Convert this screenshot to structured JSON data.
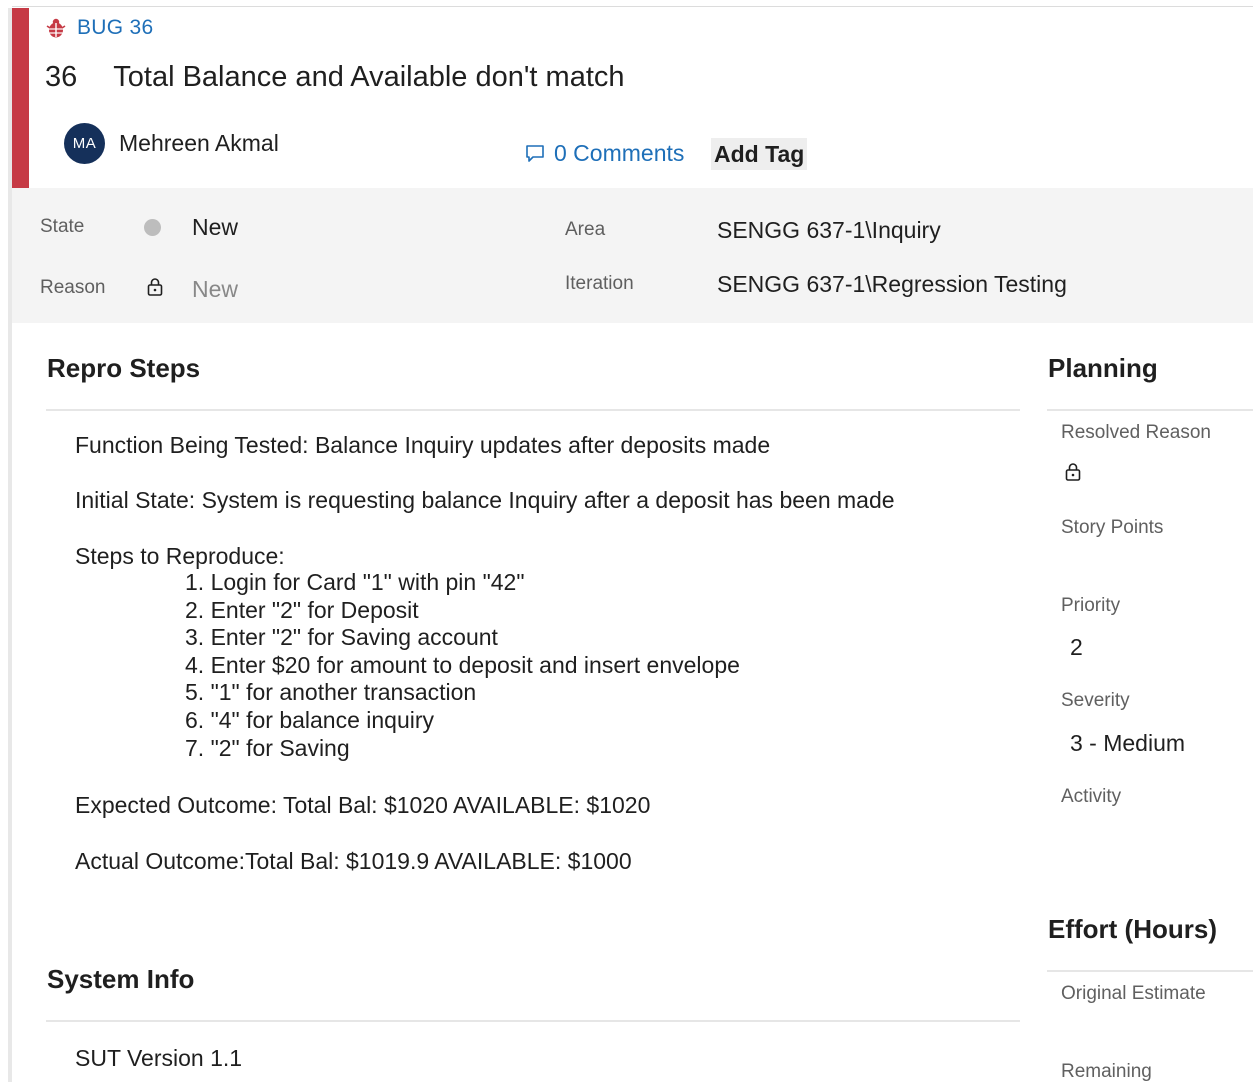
{
  "work_item": {
    "type_label": "BUG 36",
    "id": "36",
    "title": "Total Balance and Available don't match",
    "assignee_initials": "MA",
    "assignee_name": "Mehreen Akmal",
    "comments_label": "0 Comments",
    "add_tag_label": "Add Tag"
  },
  "fields": {
    "state_label": "State",
    "state_value": "New",
    "reason_label": "Reason",
    "reason_value": "New",
    "area_label": "Area",
    "area_value": "SENGG 637-1\\Inquiry",
    "iteration_label": "Iteration",
    "iteration_value": "SENGG 637-1\\Regression Testing"
  },
  "repro": {
    "heading": "Repro Steps",
    "function_line": "Function Being Tested: Balance Inquiry updates after deposits made",
    "initial_state_line": "Initial State: System is requesting balance Inquiry after a deposit has been made",
    "steps_heading": "Steps to Reproduce:",
    "steps": [
      "1. Login for Card \"1\" with pin \"42\"",
      "2. Enter \"2\"  for Deposit",
      "3. Enter \"2\" for Saving account",
      "4. Enter $20 for amount to deposit and insert envelope",
      "5. \"1\" for another transaction",
      "6. \"4\" for balance inquiry",
      "7. \"2\" for Saving"
    ],
    "expected_line": "Expected Outcome:  Total Bal: $1020 AVAILABLE: $1020",
    "actual_line": "Actual Outcome:Total Bal: $1019.9 AVAILABLE: $1000"
  },
  "system_info": {
    "heading": "System Info",
    "version_line": "SUT Version 1.1"
  },
  "planning": {
    "heading": "Planning",
    "resolved_reason_label": "Resolved Reason",
    "story_points_label": "Story Points",
    "priority_label": "Priority",
    "priority_value": "2",
    "severity_label": "Severity",
    "severity_value": "3 - Medium",
    "activity_label": "Activity"
  },
  "effort": {
    "heading": "Effort (Hours)",
    "original_estimate_label": "Original Estimate",
    "remaining_label": "Remaining"
  },
  "colors": {
    "accent_red": "#c63a45",
    "link_blue": "#1e6fb8",
    "avatar_navy": "#15305a"
  },
  "icons": {
    "type_icon": "bug-icon",
    "comments_icon": "speech-bubble-icon",
    "reason_icon": "lock-icon",
    "resolved_reason_icon": "lock-icon",
    "state_indicator": "state-dot"
  }
}
